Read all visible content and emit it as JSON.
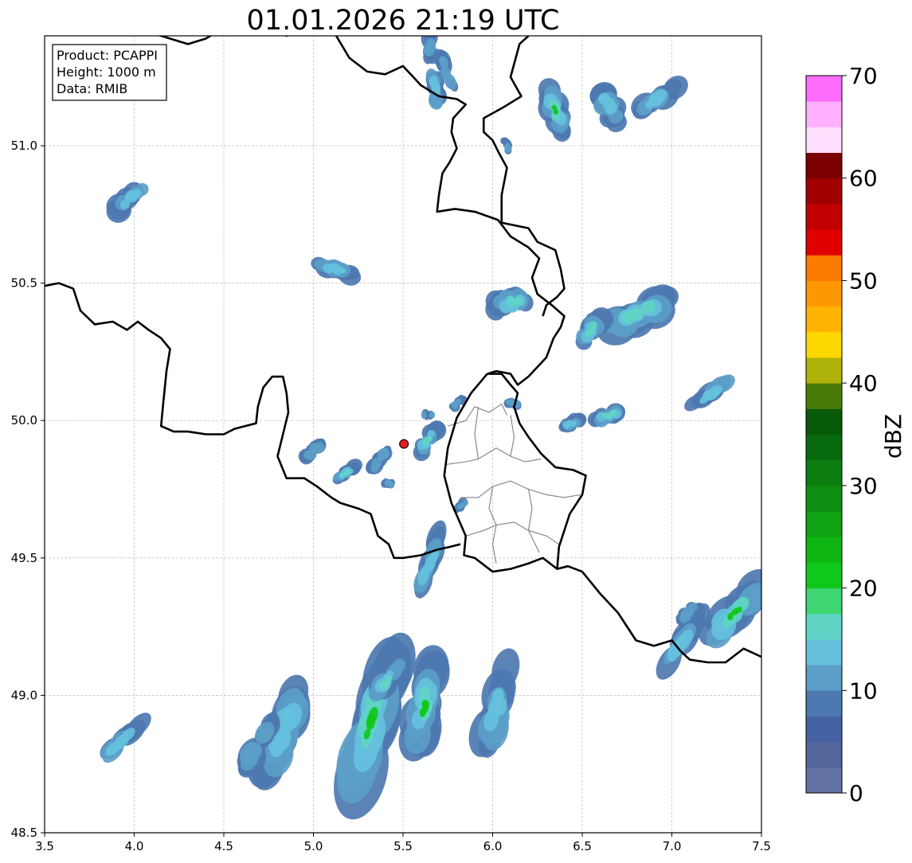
{
  "title": "01.01.2026 21:19 UTC",
  "info_box": {
    "lines": [
      "Product: PCAPPI",
      "Height: 1000 m",
      "Data: RMIB"
    ]
  },
  "colorbar": {
    "label": "dBZ",
    "ticks": [
      0,
      10,
      20,
      30,
      40,
      50,
      60,
      70
    ],
    "min": 0,
    "max": 70,
    "step": 2.5,
    "colors": [
      "#6473a6",
      "#53669c",
      "#4462a3",
      "#4d78b0",
      "#5b9ec8",
      "#64c0dc",
      "#5fd4c4",
      "#3ed573",
      "#10c81a",
      "#0fb512",
      "#0fa212",
      "#0f8f12",
      "#0c7d0f",
      "#076a0c",
      "#075a08",
      "#4a7b08",
      "#afb208",
      "#fed700",
      "#fdb300",
      "#fd9800",
      "#fd7b00",
      "#e00000",
      "#c00000",
      "#a00000",
      "#7c0000",
      "#ffdfff",
      "#ffb0ff",
      "#ff6dff",
      "#ef38ef"
    ]
  },
  "map": {
    "lon_range": [
      3.5,
      7.5
    ],
    "lat_range": [
      48.5,
      51.4
    ],
    "x_ticks": [
      3.5,
      4.0,
      4.5,
      5.0,
      5.5,
      6.0,
      6.5,
      7.0,
      7.5
    ],
    "y_ticks": [
      48.5,
      49.0,
      49.5,
      50.0,
      50.5,
      51.0
    ],
    "grid": true,
    "radar_site": {
      "lon": 5.505,
      "lat": 49.915,
      "color": "#e02020"
    },
    "borders": [
      [
        [
          3.5,
          50.49
        ],
        [
          3.58,
          50.5
        ],
        [
          3.66,
          50.48
        ],
        [
          3.7,
          50.4
        ],
        [
          3.78,
          50.35
        ],
        [
          3.88,
          50.36
        ],
        [
          3.96,
          50.33
        ],
        [
          4.02,
          50.36
        ],
        [
          4.08,
          50.33
        ],
        [
          4.15,
          50.3
        ],
        [
          4.2,
          50.26
        ],
        [
          4.18,
          50.18
        ],
        [
          4.16,
          50.05
        ],
        [
          4.15,
          49.98
        ],
        [
          4.22,
          49.96
        ],
        [
          4.3,
          49.96
        ],
        [
          4.4,
          49.95
        ],
        [
          4.5,
          49.95
        ],
        [
          4.56,
          49.97
        ],
        [
          4.62,
          49.98
        ],
        [
          4.68,
          49.99
        ],
        [
          4.69,
          50.05
        ],
        [
          4.72,
          50.12
        ],
        [
          4.77,
          50.16
        ],
        [
          4.83,
          50.16
        ],
        [
          4.85,
          50.1
        ],
        [
          4.86,
          50.03
        ],
        [
          4.83,
          49.95
        ],
        [
          4.8,
          49.87
        ],
        [
          4.85,
          49.79
        ],
        [
          4.95,
          49.79
        ],
        [
          5.02,
          49.76
        ],
        [
          5.1,
          49.72
        ],
        [
          5.15,
          49.7
        ],
        [
          5.25,
          49.68
        ],
        [
          5.32,
          49.66
        ],
        [
          5.36,
          49.58
        ],
        [
          5.42,
          49.55
        ],
        [
          5.45,
          49.5
        ],
        [
          5.5,
          49.5
        ],
        [
          5.6,
          49.51
        ],
        [
          5.69,
          49.53
        ],
        [
          5.76,
          49.54
        ],
        [
          5.82,
          49.55
        ]
      ],
      [
        [
          4.0,
          51.45
        ],
        [
          4.1,
          51.41
        ],
        [
          4.2,
          51.39
        ],
        [
          4.3,
          51.37
        ],
        [
          4.4,
          51.39
        ],
        [
          4.5,
          51.43
        ],
        [
          4.6,
          51.46
        ],
        [
          4.7,
          51.45
        ],
        [
          4.78,
          51.42
        ],
        [
          4.85,
          51.4
        ],
        [
          4.92,
          51.43
        ],
        [
          5.01,
          51.46
        ],
        [
          5.1,
          51.43
        ],
        [
          5.2,
          51.32
        ],
        [
          5.3,
          51.27
        ],
        [
          5.4,
          51.26
        ],
        [
          5.5,
          51.29
        ],
        [
          5.6,
          51.22
        ],
        [
          5.7,
          51.18
        ],
        [
          5.8,
          51.17
        ],
        [
          5.85,
          51.15
        ],
        [
          5.78,
          51.1
        ],
        [
          5.77,
          51.05
        ],
        [
          5.8,
          50.99
        ],
        [
          5.76,
          50.94
        ],
        [
          5.72,
          50.9
        ],
        [
          5.7,
          50.82
        ],
        [
          5.69,
          50.76
        ],
        [
          5.79,
          50.77
        ],
        [
          5.9,
          50.76
        ],
        [
          6.03,
          50.73
        ],
        [
          6.1,
          50.67
        ],
        [
          6.2,
          50.63
        ],
        [
          6.26,
          50.59
        ],
        [
          6.22,
          50.52
        ],
        [
          6.25,
          50.46
        ],
        [
          6.33,
          50.42
        ],
        [
          6.4,
          50.38
        ],
        [
          6.38,
          50.34
        ],
        [
          6.34,
          50.3
        ],
        [
          6.3,
          50.23
        ],
        [
          6.2,
          50.16
        ],
        [
          6.14,
          50.13
        ],
        [
          6.1,
          50.17
        ],
        [
          6.02,
          50.18
        ],
        [
          5.97,
          50.17
        ]
      ],
      [
        [
          5.97,
          50.17
        ],
        [
          5.88,
          50.1
        ],
        [
          5.8,
          50.01
        ],
        [
          5.75,
          49.9
        ],
        [
          5.73,
          49.8
        ],
        [
          5.77,
          49.7
        ],
        [
          5.85,
          49.58
        ],
        [
          5.84,
          49.51
        ],
        [
          5.9,
          49.5
        ],
        [
          6.0,
          49.45
        ],
        [
          6.1,
          49.46
        ],
        [
          6.2,
          49.48
        ],
        [
          6.28,
          49.5
        ],
        [
          6.36,
          49.46
        ],
        [
          6.42,
          49.47
        ],
        [
          6.5,
          49.45
        ]
      ],
      [
        [
          5.97,
          50.17
        ],
        [
          6.05,
          50.17
        ],
        [
          6.1,
          50.13
        ],
        [
          6.14,
          50.1
        ],
        [
          6.12,
          50.05
        ],
        [
          6.15,
          49.99
        ],
        [
          6.2,
          49.94
        ],
        [
          6.27,
          49.88
        ],
        [
          6.35,
          49.83
        ],
        [
          6.45,
          49.82
        ],
        [
          6.52,
          49.8
        ],
        [
          6.5,
          49.73
        ],
        [
          6.43,
          49.66
        ],
        [
          6.4,
          49.6
        ],
        [
          6.37,
          49.54
        ],
        [
          6.36,
          49.46
        ]
      ],
      [
        [
          6.28,
          50.38
        ],
        [
          6.3,
          50.42
        ],
        [
          6.36,
          50.45
        ],
        [
          6.4,
          50.48
        ],
        [
          6.38,
          50.55
        ],
        [
          6.35,
          50.62
        ],
        [
          6.25,
          50.65
        ],
        [
          6.2,
          50.7
        ],
        [
          6.05,
          50.72
        ],
        [
          6.05,
          50.82
        ],
        [
          6.08,
          50.92
        ],
        [
          6.03,
          50.98
        ],
        [
          6.0,
          51.02
        ],
        [
          5.95,
          51.05
        ],
        [
          5.95,
          51.1
        ],
        [
          6.06,
          51.14
        ],
        [
          6.16,
          51.18
        ],
        [
          6.1,
          51.25
        ],
        [
          6.15,
          51.37
        ],
        [
          6.2,
          51.4
        ]
      ],
      [
        [
          6.5,
          49.45
        ],
        [
          6.6,
          49.37
        ],
        [
          6.7,
          49.3
        ],
        [
          6.8,
          49.2
        ],
        [
          6.9,
          49.18
        ],
        [
          7.0,
          49.2
        ],
        [
          7.05,
          49.16
        ],
        [
          7.1,
          49.13
        ],
        [
          7.2,
          49.12
        ],
        [
          7.3,
          49.12
        ],
        [
          7.4,
          49.17
        ],
        [
          7.5,
          49.14
        ]
      ]
    ],
    "districts": [
      [
        [
          5.75,
          49.98
        ],
        [
          5.85,
          50.0
        ],
        [
          5.9,
          50.05
        ],
        [
          5.98,
          50.03
        ],
        [
          6.05,
          50.06
        ],
        [
          6.08,
          50.02
        ]
      ],
      [
        [
          5.74,
          49.84
        ],
        [
          5.85,
          49.85
        ],
        [
          5.92,
          49.86
        ],
        [
          6.02,
          49.9
        ],
        [
          6.1,
          49.87
        ],
        [
          6.18,
          49.85
        ],
        [
          6.27,
          49.86
        ]
      ],
      [
        [
          5.82,
          49.72
        ],
        [
          5.92,
          49.72
        ],
        [
          6.0,
          49.76
        ],
        [
          6.1,
          49.78
        ],
        [
          6.2,
          49.75
        ],
        [
          6.3,
          49.73
        ],
        [
          6.4,
          49.72
        ],
        [
          6.49,
          49.73
        ]
      ],
      [
        [
          5.85,
          49.58
        ],
        [
          5.95,
          49.6
        ],
        [
          6.02,
          49.62
        ],
        [
          6.12,
          49.63
        ],
        [
          6.2,
          49.6
        ],
        [
          6.3,
          49.58
        ],
        [
          6.37,
          49.55
        ]
      ],
      [
        [
          6.0,
          49.76
        ],
        [
          5.98,
          49.68
        ],
        [
          6.02,
          49.62
        ],
        [
          6.0,
          49.55
        ],
        [
          6.02,
          49.48
        ]
      ],
      [
        [
          6.2,
          49.75
        ],
        [
          6.22,
          49.68
        ],
        [
          6.2,
          49.6
        ],
        [
          6.26,
          49.52
        ]
      ],
      [
        [
          5.92,
          49.86
        ],
        [
          5.9,
          49.95
        ],
        [
          5.92,
          50.05
        ]
      ],
      [
        [
          6.1,
          49.87
        ],
        [
          6.12,
          49.94
        ],
        [
          6.1,
          50.02
        ]
      ]
    ],
    "echoes": [
      {
        "lon": 3.98,
        "lat": 50.81,
        "a": 0.05,
        "b": 0.13,
        "angle": -35,
        "core": 2
      },
      {
        "lon": 5.12,
        "lat": 50.55,
        "a": 0.04,
        "b": 0.12,
        "angle": 15,
        "core": 2
      },
      {
        "lon": 6.11,
        "lat": 50.43,
        "a": 0.06,
        "b": 0.13,
        "angle": -15,
        "core": 3
      },
      {
        "lon": 6.35,
        "lat": 51.13,
        "a": 0.06,
        "b": 0.16,
        "angle": 70,
        "core": 4
      },
      {
        "lon": 6.65,
        "lat": 51.14,
        "a": 0.06,
        "b": 0.13,
        "angle": 60,
        "core": 2
      },
      {
        "lon": 6.92,
        "lat": 51.17,
        "a": 0.05,
        "b": 0.15,
        "angle": -40,
        "core": 2
      },
      {
        "lon": 5.68,
        "lat": 51.21,
        "a": 0.04,
        "b": 0.12,
        "angle": 80,
        "core": 2
      },
      {
        "lon": 5.74,
        "lat": 51.27,
        "a": 0.03,
        "b": 0.11,
        "angle": 70,
        "core": 1
      },
      {
        "lon": 5.65,
        "lat": 51.37,
        "a": 0.03,
        "b": 0.1,
        "angle": 90,
        "core": 1
      },
      {
        "lon": 6.08,
        "lat": 51.0,
        "a": 0.02,
        "b": 0.05,
        "angle": 60,
        "core": 1
      },
      {
        "lon": 6.82,
        "lat": 50.39,
        "a": 0.08,
        "b": 0.22,
        "angle": -25,
        "core": 3
      },
      {
        "lon": 6.55,
        "lat": 50.33,
        "a": 0.05,
        "b": 0.12,
        "angle": -50,
        "core": 3
      },
      {
        "lon": 7.22,
        "lat": 50.1,
        "a": 0.04,
        "b": 0.15,
        "angle": -35,
        "core": 2
      },
      {
        "lon": 6.65,
        "lat": 50.02,
        "a": 0.04,
        "b": 0.1,
        "angle": -20,
        "core": 3
      },
      {
        "lon": 6.44,
        "lat": 49.99,
        "a": 0.03,
        "b": 0.07,
        "angle": -20,
        "core": 2
      },
      {
        "lon": 5.0,
        "lat": 49.89,
        "a": 0.03,
        "b": 0.08,
        "angle": -45,
        "core": 1
      },
      {
        "lon": 5.18,
        "lat": 49.81,
        "a": 0.03,
        "b": 0.09,
        "angle": -30,
        "core": 3
      },
      {
        "lon": 5.37,
        "lat": 49.86,
        "a": 0.03,
        "b": 0.09,
        "angle": -55,
        "core": 1
      },
      {
        "lon": 5.64,
        "lat": 49.93,
        "a": 0.04,
        "b": 0.1,
        "angle": -55,
        "core": 3
      },
      {
        "lon": 5.8,
        "lat": 50.06,
        "a": 0.02,
        "b": 0.05,
        "angle": -40,
        "core": 1
      },
      {
        "lon": 5.64,
        "lat": 50.02,
        "a": 0.02,
        "b": 0.04,
        "angle": 0,
        "core": 1
      },
      {
        "lon": 5.42,
        "lat": 49.77,
        "a": 0.02,
        "b": 0.04,
        "angle": 0,
        "core": 1
      },
      {
        "lon": 5.82,
        "lat": 49.69,
        "a": 0.02,
        "b": 0.05,
        "angle": -40,
        "core": 1
      },
      {
        "lon": 6.12,
        "lat": 50.06,
        "a": 0.02,
        "b": 0.05,
        "angle": 10,
        "core": 1
      },
      {
        "lon": 5.65,
        "lat": 49.48,
        "a": 0.04,
        "b": 0.19,
        "angle": -70,
        "core": 2
      },
      {
        "lon": 5.32,
        "lat": 48.9,
        "a": 0.11,
        "b": 0.48,
        "angle": -75,
        "core": 4
      },
      {
        "lon": 4.83,
        "lat": 48.86,
        "a": 0.08,
        "b": 0.28,
        "angle": -70,
        "core": 2
      },
      {
        "lon": 5.62,
        "lat": 48.96,
        "a": 0.08,
        "b": 0.27,
        "angle": -80,
        "core": 4
      },
      {
        "lon": 6.03,
        "lat": 48.96,
        "a": 0.07,
        "b": 0.27,
        "angle": -75,
        "core": 2
      },
      {
        "lon": 5.42,
        "lat": 49.06,
        "a": 0.05,
        "b": 0.16,
        "angle": -50,
        "core": 3
      },
      {
        "lon": 4.7,
        "lat": 48.82,
        "a": 0.05,
        "b": 0.17,
        "angle": -55,
        "core": 1
      },
      {
        "lon": 3.92,
        "lat": 48.83,
        "a": 0.04,
        "b": 0.18,
        "angle": -45,
        "core": 2
      },
      {
        "lon": 7.35,
        "lat": 49.3,
        "a": 0.08,
        "b": 0.25,
        "angle": -45,
        "core": 4
      },
      {
        "lon": 7.05,
        "lat": 49.19,
        "a": 0.05,
        "b": 0.22,
        "angle": -60,
        "core": 2
      },
      {
        "lon": 7.09,
        "lat": 49.3,
        "a": 0.03,
        "b": 0.07,
        "angle": -40,
        "core": 1
      }
    ]
  }
}
